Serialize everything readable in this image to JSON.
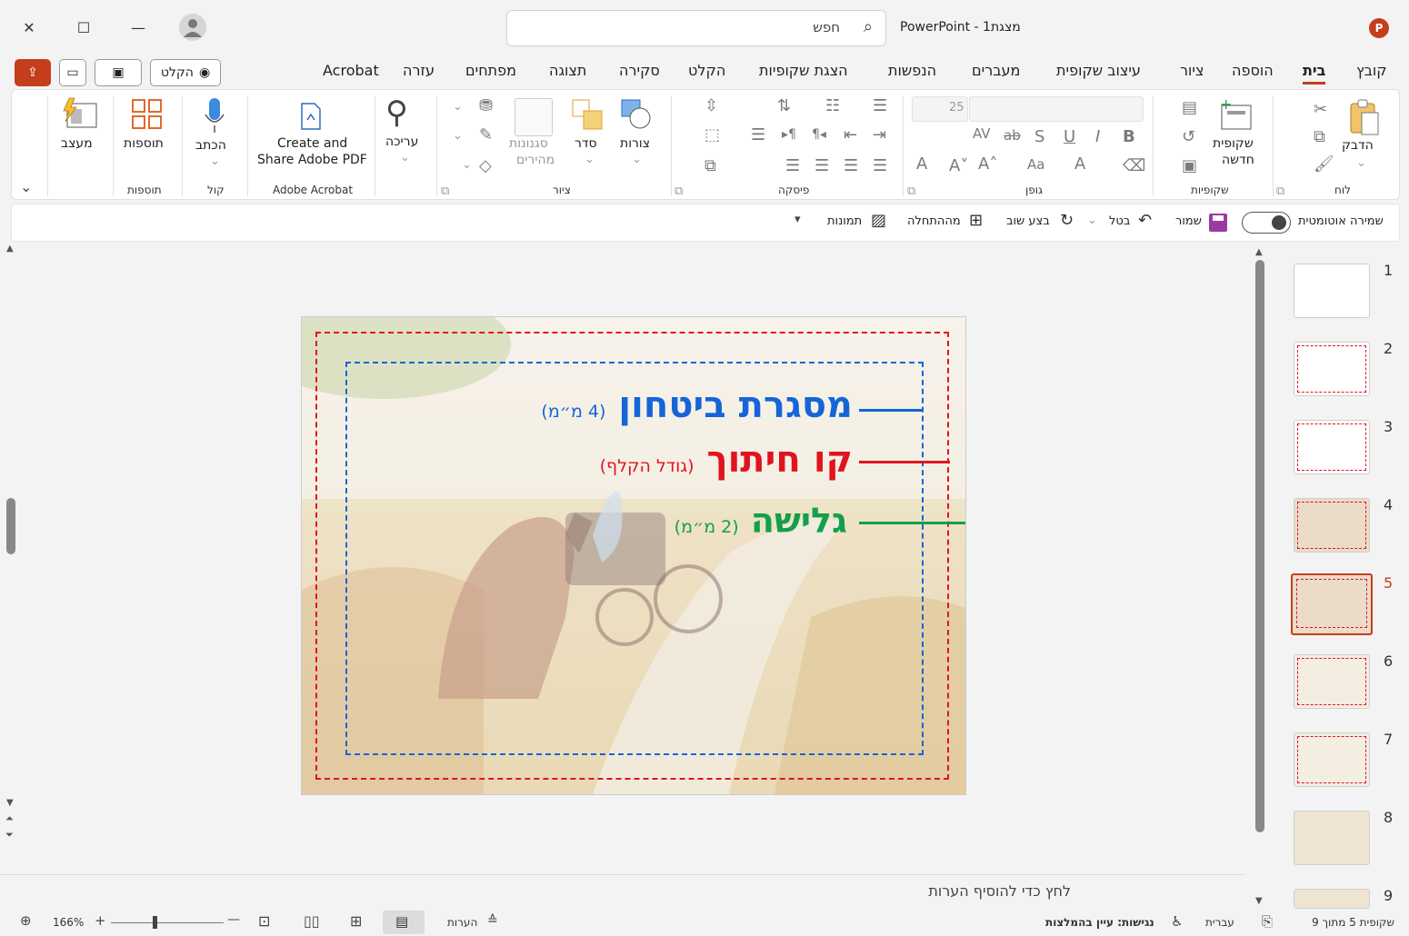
{
  "window": {
    "title": "מצגת1 - PowerPoint",
    "search_placeholder": "חפש",
    "close": "✕",
    "maximize": "☐",
    "minimize": "—"
  },
  "top_buttons": {
    "record": "הקלט"
  },
  "tabs": [
    "קובץ",
    "בית",
    "הוספה",
    "ציור",
    "עיצוב שקופית",
    "מעברים",
    "הנפשות",
    "הצגת שקופיות",
    "הקלט",
    "סקירה",
    "תצוגה",
    "מפתחים",
    "עזרה",
    "Acrobat"
  ],
  "active_tab": "בית",
  "ribbon": {
    "clipboard": {
      "paste": "הדבק",
      "group": "לוח"
    },
    "slides": {
      "new_slide_1": "שקופית",
      "new_slide_2": "חדשה",
      "group": "שקופיות"
    },
    "font": {
      "size": "25",
      "group": "גופן"
    },
    "paragraph": {
      "group": "פיסקה"
    },
    "drawing": {
      "shapes": "צורות",
      "arrange": "סדר",
      "quick_styles_1": "סגנונות",
      "quick_styles_2": "מהירים",
      "group": "ציור"
    },
    "editing": {
      "label": "עריכה"
    },
    "acrobat": {
      "line1": "Create and",
      "line2": "Share Adobe PDF",
      "group": "Adobe Acrobat"
    },
    "voice": {
      "dictate": "הכתב",
      "group": "קול"
    },
    "addins": {
      "label": "תוספות",
      "group": "תוספות"
    },
    "designer": {
      "label": "מעצב"
    }
  },
  "qat": {
    "autosave": "שמירה אוטומטית",
    "save": "שמור",
    "undo": "בטל",
    "redo": "בצע שוב",
    "from_start": "מההתחלה",
    "pictures": "תמונות"
  },
  "slide": {
    "line1": "מסגרת ביטחון",
    "line1_note": "(4 מ״מ)",
    "line2": "קו חיתוך",
    "line2_note": "(גודל הקלף)",
    "line3": "גלישה",
    "line3_note": "(2 מ״מ)"
  },
  "colors": {
    "blue": "#1565d8",
    "red": "#e0141e",
    "green": "#12a04a",
    "accent": "#c43e1c"
  },
  "thumbnails": [
    "1",
    "2",
    "3",
    "4",
    "5",
    "6",
    "7",
    "8",
    "9"
  ],
  "selected_slide": "5",
  "notes_placeholder": "לחץ כדי להוסיף הערות",
  "status": {
    "slide_info": "שקופית 5 מתוך 9",
    "language": "עברית",
    "accessibility": "נגישות: עיין בהמלצות",
    "notes": "הערות",
    "zoom": "166%"
  }
}
